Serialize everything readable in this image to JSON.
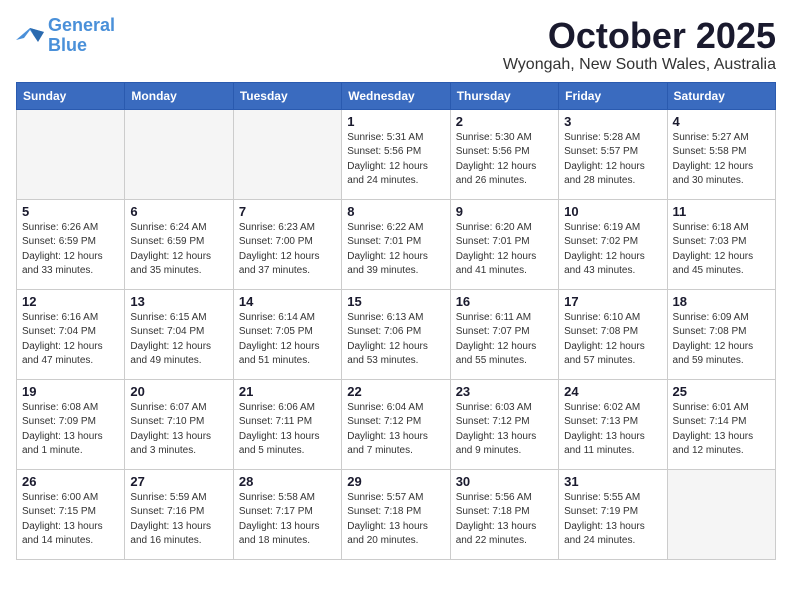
{
  "logo": {
    "line1": "General",
    "line2": "Blue"
  },
  "title": "October 2025",
  "location": "Wyongah, New South Wales, Australia",
  "days_of_week": [
    "Sunday",
    "Monday",
    "Tuesday",
    "Wednesday",
    "Thursday",
    "Friday",
    "Saturday"
  ],
  "weeks": [
    [
      {
        "day": "",
        "info": ""
      },
      {
        "day": "",
        "info": ""
      },
      {
        "day": "",
        "info": ""
      },
      {
        "day": "1",
        "info": "Sunrise: 5:31 AM\nSunset: 5:56 PM\nDaylight: 12 hours\nand 24 minutes."
      },
      {
        "day": "2",
        "info": "Sunrise: 5:30 AM\nSunset: 5:56 PM\nDaylight: 12 hours\nand 26 minutes."
      },
      {
        "day": "3",
        "info": "Sunrise: 5:28 AM\nSunset: 5:57 PM\nDaylight: 12 hours\nand 28 minutes."
      },
      {
        "day": "4",
        "info": "Sunrise: 5:27 AM\nSunset: 5:58 PM\nDaylight: 12 hours\nand 30 minutes."
      }
    ],
    [
      {
        "day": "5",
        "info": "Sunrise: 6:26 AM\nSunset: 6:59 PM\nDaylight: 12 hours\nand 33 minutes."
      },
      {
        "day": "6",
        "info": "Sunrise: 6:24 AM\nSunset: 6:59 PM\nDaylight: 12 hours\nand 35 minutes."
      },
      {
        "day": "7",
        "info": "Sunrise: 6:23 AM\nSunset: 7:00 PM\nDaylight: 12 hours\nand 37 minutes."
      },
      {
        "day": "8",
        "info": "Sunrise: 6:22 AM\nSunset: 7:01 PM\nDaylight: 12 hours\nand 39 minutes."
      },
      {
        "day": "9",
        "info": "Sunrise: 6:20 AM\nSunset: 7:01 PM\nDaylight: 12 hours\nand 41 minutes."
      },
      {
        "day": "10",
        "info": "Sunrise: 6:19 AM\nSunset: 7:02 PM\nDaylight: 12 hours\nand 43 minutes."
      },
      {
        "day": "11",
        "info": "Sunrise: 6:18 AM\nSunset: 7:03 PM\nDaylight: 12 hours\nand 45 minutes."
      }
    ],
    [
      {
        "day": "12",
        "info": "Sunrise: 6:16 AM\nSunset: 7:04 PM\nDaylight: 12 hours\nand 47 minutes."
      },
      {
        "day": "13",
        "info": "Sunrise: 6:15 AM\nSunset: 7:04 PM\nDaylight: 12 hours\nand 49 minutes."
      },
      {
        "day": "14",
        "info": "Sunrise: 6:14 AM\nSunset: 7:05 PM\nDaylight: 12 hours\nand 51 minutes."
      },
      {
        "day": "15",
        "info": "Sunrise: 6:13 AM\nSunset: 7:06 PM\nDaylight: 12 hours\nand 53 minutes."
      },
      {
        "day": "16",
        "info": "Sunrise: 6:11 AM\nSunset: 7:07 PM\nDaylight: 12 hours\nand 55 minutes."
      },
      {
        "day": "17",
        "info": "Sunrise: 6:10 AM\nSunset: 7:08 PM\nDaylight: 12 hours\nand 57 minutes."
      },
      {
        "day": "18",
        "info": "Sunrise: 6:09 AM\nSunset: 7:08 PM\nDaylight: 12 hours\nand 59 minutes."
      }
    ],
    [
      {
        "day": "19",
        "info": "Sunrise: 6:08 AM\nSunset: 7:09 PM\nDaylight: 13 hours\nand 1 minute."
      },
      {
        "day": "20",
        "info": "Sunrise: 6:07 AM\nSunset: 7:10 PM\nDaylight: 13 hours\nand 3 minutes."
      },
      {
        "day": "21",
        "info": "Sunrise: 6:06 AM\nSunset: 7:11 PM\nDaylight: 13 hours\nand 5 minutes."
      },
      {
        "day": "22",
        "info": "Sunrise: 6:04 AM\nSunset: 7:12 PM\nDaylight: 13 hours\nand 7 minutes."
      },
      {
        "day": "23",
        "info": "Sunrise: 6:03 AM\nSunset: 7:12 PM\nDaylight: 13 hours\nand 9 minutes."
      },
      {
        "day": "24",
        "info": "Sunrise: 6:02 AM\nSunset: 7:13 PM\nDaylight: 13 hours\nand 11 minutes."
      },
      {
        "day": "25",
        "info": "Sunrise: 6:01 AM\nSunset: 7:14 PM\nDaylight: 13 hours\nand 12 minutes."
      }
    ],
    [
      {
        "day": "26",
        "info": "Sunrise: 6:00 AM\nSunset: 7:15 PM\nDaylight: 13 hours\nand 14 minutes."
      },
      {
        "day": "27",
        "info": "Sunrise: 5:59 AM\nSunset: 7:16 PM\nDaylight: 13 hours\nand 16 minutes."
      },
      {
        "day": "28",
        "info": "Sunrise: 5:58 AM\nSunset: 7:17 PM\nDaylight: 13 hours\nand 18 minutes."
      },
      {
        "day": "29",
        "info": "Sunrise: 5:57 AM\nSunset: 7:18 PM\nDaylight: 13 hours\nand 20 minutes."
      },
      {
        "day": "30",
        "info": "Sunrise: 5:56 AM\nSunset: 7:18 PM\nDaylight: 13 hours\nand 22 minutes."
      },
      {
        "day": "31",
        "info": "Sunrise: 5:55 AM\nSunset: 7:19 PM\nDaylight: 13 hours\nand 24 minutes."
      },
      {
        "day": "",
        "info": ""
      }
    ]
  ]
}
